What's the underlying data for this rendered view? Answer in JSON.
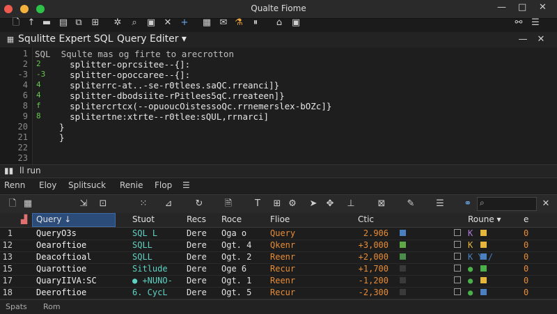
{
  "window": {
    "title": "Qualte Fiome",
    "minimize": "—",
    "maximize": "□",
    "close": "✕"
  },
  "editor": {
    "title": "Squlitte Expert SQL",
    "subtitle": "Query Editer ▾",
    "header_extra": "SQL",
    "line_numbers": [
      "1",
      "2",
      "-3",
      "4",
      "6",
      "8",
      "9",
      "20",
      "21",
      "22",
      "23"
    ],
    "fold_markers": [
      "",
      "2",
      "-3",
      "4",
      "4",
      "f",
      "8",
      "",
      "",
      "",
      ""
    ],
    "lines": [
      "SQL  Squlte mas og firte to arecrotton",
      "    splitter-oprcsitee--{]:",
      "    splitter-opoccaree--{]:",
      "    spliterrc-at..-se-r0tlees.saQC.rreanci]}",
      "    splitter-dbodsiite-rPitlees5qC.rreateen]}",
      "    splitercrtcx(--opuoucOistessoQc.rrnemerslex-bOZc]}",
      "    splitertne:xtrte--r0tlee:sQUL,rrnarci]",
      "  }",
      "  }",
      "",
      ""
    ]
  },
  "divider": {
    "label": "ll run"
  },
  "menu": [
    "Renn",
    "Eloy",
    "Splitsuck",
    "Renie",
    "Flop"
  ],
  "grid": {
    "columns": [
      "Query ↓",
      "Stuot",
      "Recs",
      "Roce",
      "Flioe",
      "Ctic",
      "Roune ▾",
      "e"
    ],
    "rows": [
      {
        "num": "1",
        "query": "QueryO3s",
        "stud": "SQL L",
        "recs": "Dere",
        "roce": "Oga o",
        "flow": "Query",
        "ctic": "2.906",
        "route": "K",
        "zero": "0",
        "sq": "#4a7fc0",
        "sq2": "#e6b63b",
        "rc": "#b07ad8"
      },
      {
        "num": "12",
        "query": "Oearoftioe",
        "stud": "SQLL",
        "recs": "Dere",
        "roce": "Ogt. 4",
        "flow": "Qkenr",
        "ctic": "+3,000",
        "route": "K",
        "zero": "0",
        "sq": "#5ea845",
        "sq2": "#e6b63b",
        "rc": "#e6b63b"
      },
      {
        "num": "13",
        "query": "Deacoftioal",
        "stud": "SQLL",
        "recs": "Dere",
        "roce": "Ogt. 2",
        "flow": "Reenr",
        "ctic": "+2,000",
        "route": "K Y /",
        "zero": "0",
        "sq": "#4a8c4a",
        "sq2": "#4a7fc0",
        "rc": "#4a7fc0"
      },
      {
        "num": "15",
        "query": "Quarottioe",
        "stud": "Sitlude",
        "recs": "Dere",
        "roce": "Oge 6",
        "flow": "Recur",
        "ctic": "+1,700",
        "route": "●",
        "zero": "0",
        "sq": "#3a3a3a",
        "sq2": "#4ab04a",
        "rc": "#4ab04a"
      },
      {
        "num": "17",
        "query": "QuaryIIVA:SC",
        "stud": "● +NUNO-",
        "recs": "Dere",
        "roce": "Ogt. 1",
        "flow": "Reenr",
        "ctic": "-1,200",
        "route": "●",
        "zero": "0",
        "sq": "#3a3a3a",
        "sq2": "#e6b63b",
        "rc": "#4ab04a"
      },
      {
        "num": "18",
        "query": "Deeroftioe",
        "stud": "6. CycL",
        "recs": "Dere",
        "roce": "Ogt. 5",
        "flow": "Recur",
        "ctic": "-2,300",
        "route": "●",
        "zero": "0",
        "sq": "#3a3a3a",
        "sq2": "#4a7fc0",
        "rc": "#4ab04a"
      }
    ]
  },
  "status": {
    "left": "Spats",
    "right": "Rom"
  }
}
